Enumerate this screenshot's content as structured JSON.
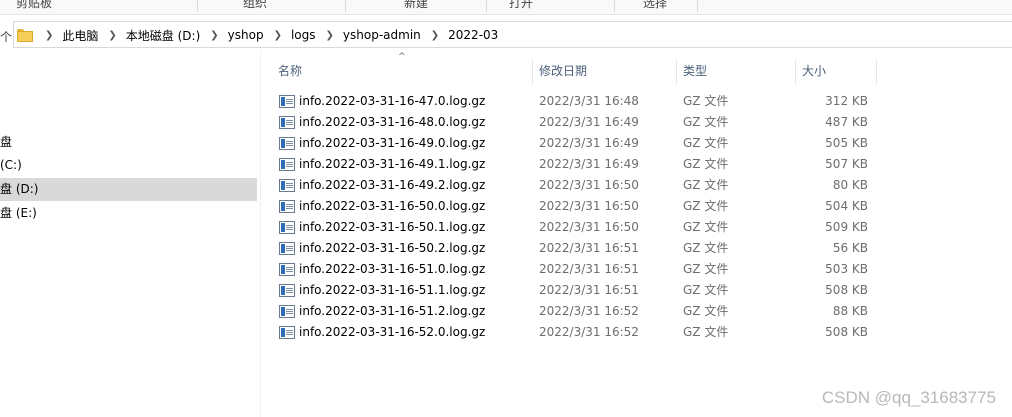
{
  "ribbon": {
    "groups": [
      "剪贴板",
      "组织",
      "新建",
      "打开",
      "选择"
    ]
  },
  "nav_arrow": "个",
  "breadcrumb": [
    "此电脑",
    "本地磁盘 (D:)",
    "yshop",
    "logs",
    "yshop-admin",
    "2022-03"
  ],
  "nav_pane": {
    "items": [
      {
        "label": "盘",
        "selected": false
      },
      {
        "label": "(C:)",
        "selected": false
      },
      {
        "label": "盘 (D:)",
        "selected": true
      },
      {
        "label": "盘 (E:)",
        "selected": false
      }
    ]
  },
  "columns": {
    "name": "名称",
    "date": "修改日期",
    "type": "类型",
    "size": "大小",
    "sort_indicator": "^"
  },
  "files": [
    {
      "name": "info.2022-03-31-16-47.0.log.gz",
      "date": "2022/3/31 16:48",
      "type": "GZ 文件",
      "size": "312 KB"
    },
    {
      "name": "info.2022-03-31-16-48.0.log.gz",
      "date": "2022/3/31 16:49",
      "type": "GZ 文件",
      "size": "487 KB"
    },
    {
      "name": "info.2022-03-31-16-49.0.log.gz",
      "date": "2022/3/31 16:49",
      "type": "GZ 文件",
      "size": "505 KB"
    },
    {
      "name": "info.2022-03-31-16-49.1.log.gz",
      "date": "2022/3/31 16:49",
      "type": "GZ 文件",
      "size": "507 KB"
    },
    {
      "name": "info.2022-03-31-16-49.2.log.gz",
      "date": "2022/3/31 16:50",
      "type": "GZ 文件",
      "size": "80 KB"
    },
    {
      "name": "info.2022-03-31-16-50.0.log.gz",
      "date": "2022/3/31 16:50",
      "type": "GZ 文件",
      "size": "504 KB"
    },
    {
      "name": "info.2022-03-31-16-50.1.log.gz",
      "date": "2022/3/31 16:50",
      "type": "GZ 文件",
      "size": "509 KB"
    },
    {
      "name": "info.2022-03-31-16-50.2.log.gz",
      "date": "2022/3/31 16:51",
      "type": "GZ 文件",
      "size": "56 KB"
    },
    {
      "name": "info.2022-03-31-16-51.0.log.gz",
      "date": "2022/3/31 16:51",
      "type": "GZ 文件",
      "size": "503 KB"
    },
    {
      "name": "info.2022-03-31-16-51.1.log.gz",
      "date": "2022/3/31 16:51",
      "type": "GZ 文件",
      "size": "508 KB"
    },
    {
      "name": "info.2022-03-31-16-51.2.log.gz",
      "date": "2022/3/31 16:52",
      "type": "GZ 文件",
      "size": "88 KB"
    },
    {
      "name": "info.2022-03-31-16-52.0.log.gz",
      "date": "2022/3/31 16:52",
      "type": "GZ 文件",
      "size": "508 KB"
    }
  ],
  "watermark": "CSDN @qq_31683775",
  "colors": {
    "selected_nav": "#d9d9d9",
    "header_text": "#4c607a",
    "secondary_text": "#6d6d6d"
  }
}
